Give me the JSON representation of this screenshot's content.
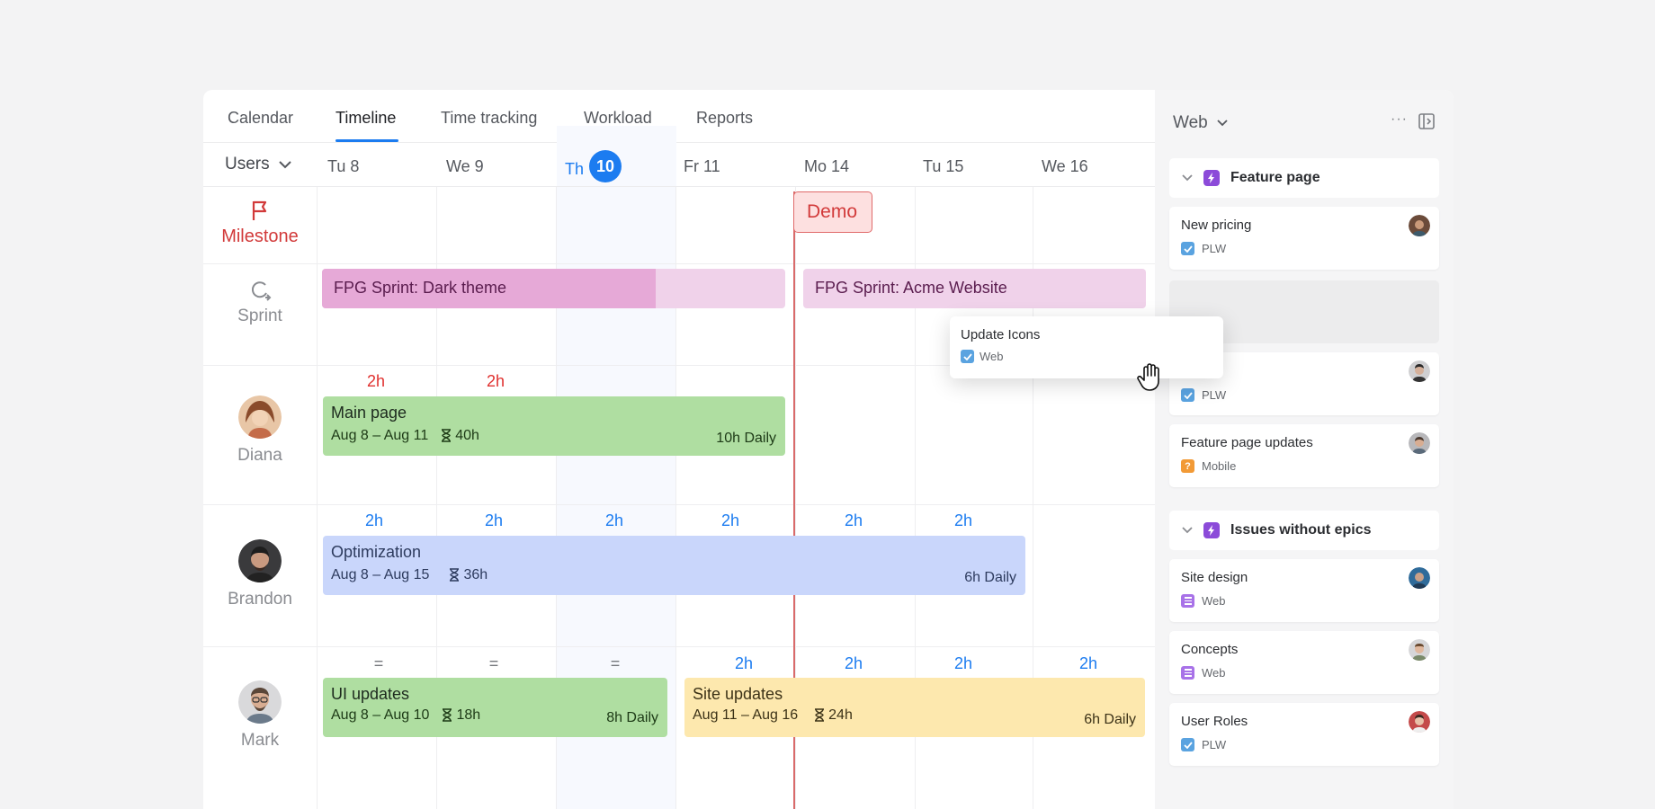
{
  "tabs": [
    "Calendar",
    "Timeline",
    "Time tracking",
    "Workload",
    "Reports"
  ],
  "active_tab": "Timeline",
  "users_dropdown": "Users",
  "days": [
    {
      "label": "Tu 8"
    },
    {
      "label": "We 9"
    },
    {
      "label": "Th",
      "badge": "10",
      "today": true
    },
    {
      "label": "Fr 11"
    },
    {
      "label": "Mo 14"
    },
    {
      "label": "Tu 15"
    },
    {
      "label": "We 16"
    }
  ],
  "rows": {
    "milestone": "Milestone",
    "sprint": "Sprint",
    "users": [
      "Diana",
      "Brandon",
      "Mark"
    ]
  },
  "milestone_event": "Demo",
  "sprints": [
    {
      "label": "FPG Sprint: Dark theme",
      "progress": 0.72
    },
    {
      "label": "FPG Sprint: Acme Website",
      "progress": 0
    }
  ],
  "hours": {
    "diana": [
      "2h",
      "2h"
    ],
    "brandon": [
      "2h",
      "2h",
      "2h",
      "2h",
      "2h",
      "2h"
    ],
    "mark": [
      "=",
      "=",
      "=",
      "2h",
      "2h",
      "2h",
      "2h"
    ]
  },
  "tasks": [
    {
      "title": "Main page",
      "dates": "Aug 8 – Aug 11",
      "estimate": "40h",
      "daily": "10h Daily"
    },
    {
      "title": "Optimization",
      "dates": "Aug 8 – Aug 15",
      "estimate": "36h",
      "daily": "6h Daily"
    },
    {
      "title": "UI updates",
      "dates": "Aug 8 – Aug 10",
      "estimate": "18h",
      "daily": "8h Daily"
    },
    {
      "title": "Site updates",
      "dates": "Aug 11 – Aug 16",
      "estimate": "24h",
      "daily": "6h Daily"
    }
  ],
  "dragging_card": {
    "title": "Update Icons",
    "tag": "Web"
  },
  "sidebar": {
    "project": "Web",
    "more": "···",
    "groups": [
      {
        "title": "Feature page",
        "cards": [
          {
            "title": "New pricing",
            "tag": "PLW",
            "tag_type": "check"
          },
          {
            "title": "",
            "tag": "PLW",
            "tag_type": "check"
          },
          {
            "title": "Feature page updates",
            "tag": "Mobile",
            "tag_type": "question"
          }
        ]
      },
      {
        "title": "Issues without epics",
        "cards": [
          {
            "title": "Site design",
            "tag": "Web",
            "tag_type": "story"
          },
          {
            "title": "Concepts",
            "tag": "Web",
            "tag_type": "story"
          },
          {
            "title": "User Roles",
            "tag": "PLW",
            "tag_type": "check"
          }
        ]
      }
    ]
  },
  "colors": {
    "accent": "#1c7cf0",
    "milestone": "#d23a3a",
    "task_green": "#afdea1",
    "task_blue": "#c9d6fb",
    "task_yellow": "#fde8ae",
    "sprint": "#f0d2ea"
  }
}
